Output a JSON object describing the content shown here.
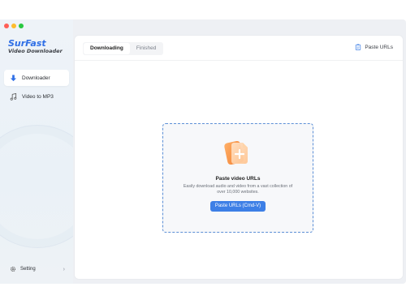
{
  "app": {
    "brand_title": "SurFast",
    "brand_subtitle": "Video Downloader"
  },
  "sidebar": {
    "items": [
      {
        "label": "Downloader",
        "icon": "download-icon",
        "active": true
      },
      {
        "label": "Video to MP3",
        "icon": "music-note-icon",
        "active": false
      }
    ],
    "setting_label": "Setting"
  },
  "main": {
    "tabs": [
      {
        "label": "Downloading",
        "active": true
      },
      {
        "label": "Finished",
        "active": false
      }
    ],
    "paste_urls_label": "Paste URLs"
  },
  "dropzone": {
    "title": "Paste video URLs",
    "description": "Easily download audio and video from a vast collection of over 10,000 websites.",
    "button_label": "Paste URLs (Cmd-V)"
  },
  "colors": {
    "accent": "#3d7fe6",
    "brand": "#2f6fe6",
    "illustration": "#f28a3c"
  }
}
